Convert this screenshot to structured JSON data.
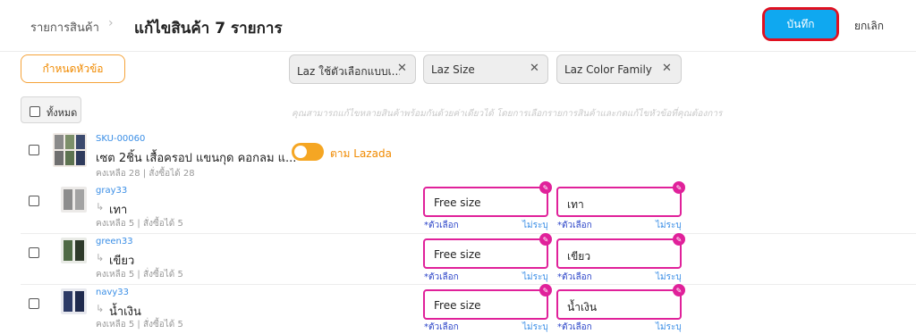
{
  "header": {
    "breadcrumb": "รายการสินค้า",
    "breadcrumb_sep": "›",
    "title": "แก้ไขสินค้า 7 รายการ",
    "save_label": "บันทึก",
    "cancel_label": "ยกเลิก"
  },
  "toolbar": {
    "set_columns_label": "กำหนดหัวข้อ",
    "chips": [
      {
        "label": "Laz ใช้ตัวเลือกแบบเ...",
        "remove": "✕"
      },
      {
        "label": "Laz Size",
        "remove": "✕"
      },
      {
        "label": "Laz Color Family",
        "remove": "✕"
      }
    ],
    "select_all_label": "ทั้งหมด",
    "hint": "คุณสามารถแก้ไขหลายสินค้าพร้อมกันด้วยค่าเดียวได้ โดยการเลือกรายการสินค้าและกดแก้ไขหัวข้อที่คุณต้องการ"
  },
  "product": {
    "sku": "SKU-00060",
    "name": "เซต 2ชิ้น เสื้อครอป แขนกุด คอกลม แ...",
    "stock": "คงเหลือ 28 | สั่งซื้อได้ 28",
    "toggle_label": "ตาม Lazada",
    "toggle_on": true
  },
  "variants": [
    {
      "sku": "gray33",
      "arrow": "↳",
      "name": "เทา",
      "stock": "คงเหลือ 5 | สั่งซื้อได้ 5",
      "size": "Free size",
      "color": "เทา"
    },
    {
      "sku": "green33",
      "arrow": "↳",
      "name": "เขียว",
      "stock": "คงเหลือ 5 | สั่งซื้อได้ 5",
      "size": "Free size",
      "color": "เขียว"
    },
    {
      "sku": "navy33",
      "arrow": "↳",
      "name": "น้ำเงิน",
      "stock": "คงเหลือ 5 | สั่งซื้อได้ 5",
      "size": "Free size",
      "color": "น้ำเงิน"
    }
  ],
  "field_labels": {
    "required": "*ตัวเลือก",
    "unspecified": "ไม่ระบุ"
  },
  "colors": {
    "accent_orange": "#f5a623",
    "save_blue": "#0fa8f0",
    "highlight_red": "#e01020",
    "field_pink": "#e0219a",
    "link_blue": "#3a8ee6"
  },
  "icons": {
    "breadcrumb": "chevron-right-icon",
    "chip_remove": "close-icon",
    "field_badge": "edit-icon"
  }
}
